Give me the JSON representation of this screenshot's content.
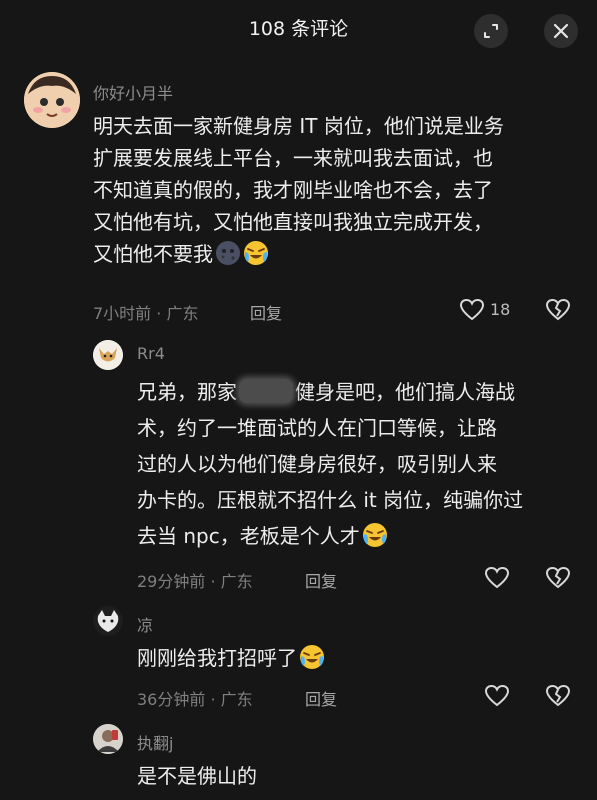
{
  "header": {
    "title": "108 条评论"
  },
  "comments": [
    {
      "username": "你好小月半",
      "lines": [
        "明天去面一家新健身房 IT 岗位，他们说是业务",
        "扩展要发展线上平台，一来就叫我去面试，也",
        "不知道真的假的，我才刚毕业啥也不会，去了",
        "又怕他有坑，又怕他直接叫我独立完成开发，",
        "又怕他不要我"
      ],
      "time": "7小时前 · 广东",
      "reply": "回复",
      "likes": "18"
    },
    {
      "username": "Rr4",
      "lines_before_blur": "兄弟，那家",
      "lines_after_blur": "健身是吧，他们搞人海战",
      "lines": [
        "术，约了一堆面试的人在门口等候，让路",
        "过的人以为他们健身房很好，吸引别人来",
        "办卡的。压根就不招什么 it 岗位，纯骗你过",
        "去当 npc，老板是个人才"
      ],
      "time": "29分钟前 · 广东",
      "reply": "回复"
    },
    {
      "username": "凉",
      "lines": [
        "刚刚给我打招呼了"
      ],
      "time": "36分钟前 · 广东",
      "reply": "回复"
    },
    {
      "username": "执翻j",
      "lines": [
        "是不是佛山的"
      ]
    }
  ],
  "icons": {
    "expand": "expand-icon",
    "close": "close-icon",
    "like": "heart-outline-icon",
    "dislike": "heart-broken-icon",
    "emoji_laugh_cry": "laugh-cry-emoji",
    "emoji_moon": "moon-face-emoji"
  }
}
